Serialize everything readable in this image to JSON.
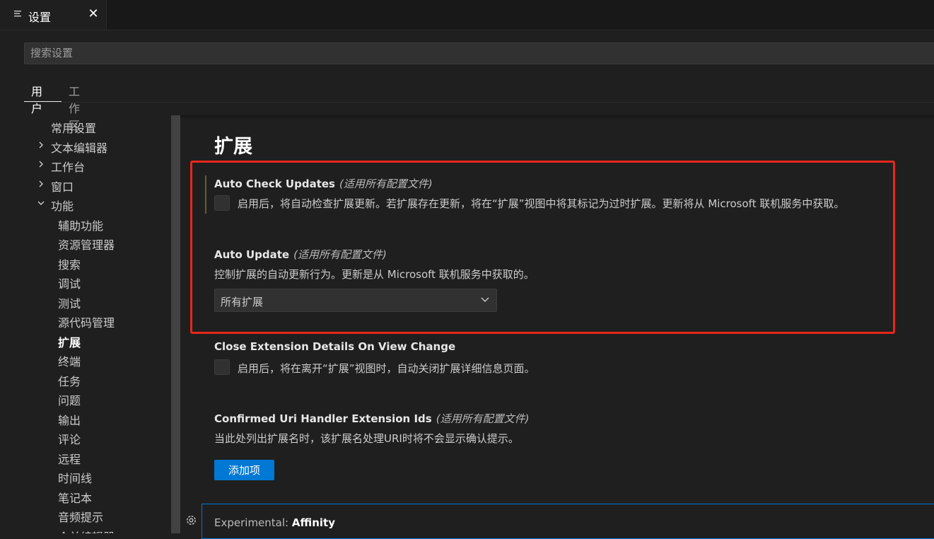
{
  "editor_tab": {
    "icon": "settings-list-icon",
    "title": "设置",
    "close_glyph": "✕"
  },
  "search": {
    "placeholder": "搜索设置",
    "value": ""
  },
  "scope_tabs": [
    {
      "label": "用户",
      "active": true
    },
    {
      "label": "工作区",
      "active": false
    }
  ],
  "toc": {
    "items": [
      {
        "label": "常用设置",
        "expander": "none"
      },
      {
        "label": "文本编辑器",
        "expander": "collapsed"
      },
      {
        "label": "工作台",
        "expander": "collapsed"
      },
      {
        "label": "窗口",
        "expander": "collapsed"
      },
      {
        "label": "功能",
        "expander": "expanded"
      }
    ],
    "children": [
      {
        "label": "辅助功能"
      },
      {
        "label": "资源管理器"
      },
      {
        "label": "搜索"
      },
      {
        "label": "调试"
      },
      {
        "label": "测试"
      },
      {
        "label": "源代码管理"
      },
      {
        "label": "扩展",
        "active": true
      },
      {
        "label": "终端"
      },
      {
        "label": "任务"
      },
      {
        "label": "问题"
      },
      {
        "label": "输出"
      },
      {
        "label": "评论"
      },
      {
        "label": "远程"
      },
      {
        "label": "时间线"
      },
      {
        "label": "笔记本"
      },
      {
        "label": "音频提示"
      },
      {
        "label": "合并编辑器"
      }
    ]
  },
  "content": {
    "section_title": "扩展",
    "settings": {
      "auto_check_updates": {
        "title": "Auto Check Updates",
        "scope_note": "(适用所有配置文件)",
        "description": "启用后，将自动检查扩展更新。若扩展存在更新，将在“扩展”视图中将其标记为过时扩展。更新将从 Microsoft 联机服务中获取。",
        "checked": false
      },
      "auto_update": {
        "title": "Auto Update",
        "scope_note": "(适用所有配置文件)",
        "description": "控制扩展的自动更新行为。更新是从 Microsoft 联机服务中获取的。",
        "selected_option": "所有扩展"
      },
      "close_extension_details": {
        "title": "Close Extension Details On View Change",
        "description": "启用后，将在离开“扩展”视图时，自动关闭扩展详细信息页面。",
        "checked": false
      },
      "confirmed_uri_handler": {
        "title": "Confirmed Uri Handler Extension Ids",
        "scope_note": "(适用所有配置文件)",
        "description": "当此处列出扩展名时，该扩展名处理URI时将不会显示确认提示。",
        "button_label": "添加项"
      },
      "experimental_affinity": {
        "category": "Experimental: ",
        "key": "Affinity"
      }
    }
  },
  "colors": {
    "background": "#1f1f1f",
    "accent": "#0078d4",
    "annotation_box": "#e8271b",
    "modified_indicator": "#6b5a35"
  }
}
